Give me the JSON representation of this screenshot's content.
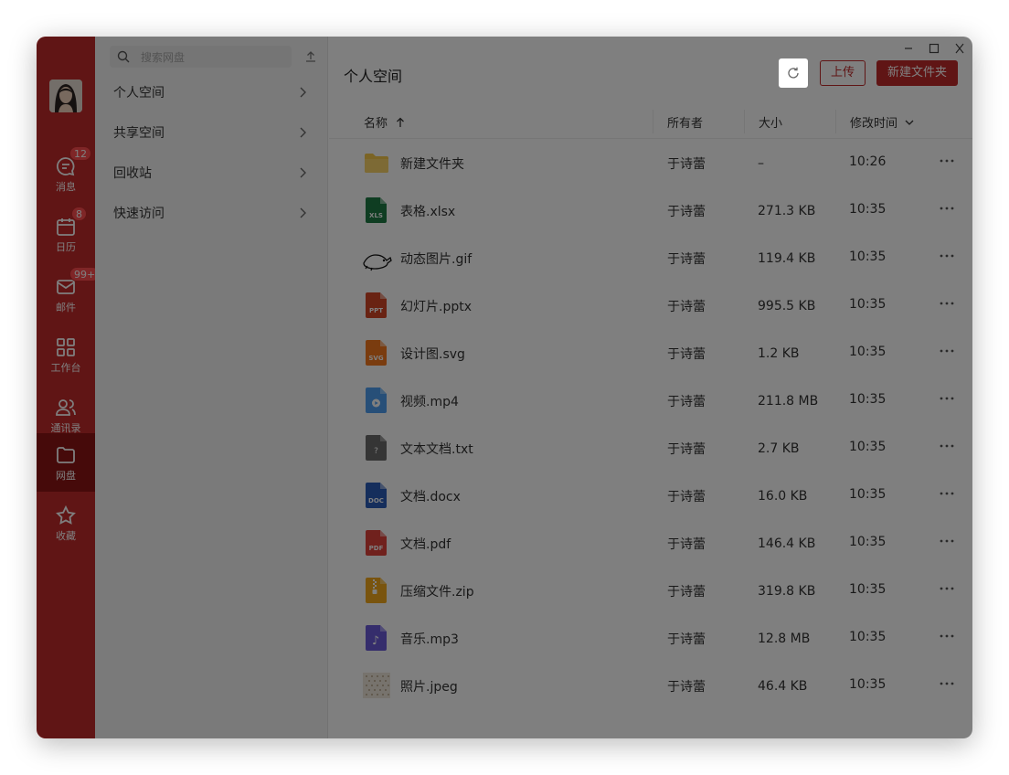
{
  "colors": {
    "brand": "#c12a2a",
    "brand_dark": "#8d1515",
    "badge": "#ff4d4f"
  },
  "rail": {
    "items": [
      {
        "label": "消息",
        "icon": "message-icon",
        "badge": "12"
      },
      {
        "label": "日历",
        "icon": "calendar-icon",
        "badge": "8"
      },
      {
        "label": "邮件",
        "icon": "mail-icon",
        "badge": "99+"
      },
      {
        "label": "工作台",
        "icon": "grid-icon",
        "badge": ""
      },
      {
        "label": "通讯录",
        "icon": "contacts-icon",
        "badge": ""
      },
      {
        "label": "网盘",
        "icon": "folder-icon",
        "badge": "",
        "active": true
      },
      {
        "label": "收藏",
        "icon": "star-icon",
        "badge": ""
      }
    ]
  },
  "panel": {
    "search_placeholder": "搜索网盘",
    "items": [
      {
        "label": "个人空间"
      },
      {
        "label": "共享空间"
      },
      {
        "label": "回收站"
      },
      {
        "label": "快速访问"
      }
    ]
  },
  "main": {
    "title": "个人空间",
    "upload_label": "上传",
    "new_folder_label": "新建文件夹",
    "columns": {
      "name": "名称",
      "owner": "所有者",
      "size": "大小",
      "modified": "修改时间"
    },
    "files": [
      {
        "name": "新建文件夹",
        "owner": "于诗蕾",
        "size": "–",
        "time": "10:26",
        "type": "folder"
      },
      {
        "name": "表格.xlsx",
        "owner": "于诗蕾",
        "size": "271.3 KB",
        "time": "10:35",
        "type": "xls"
      },
      {
        "name": "动态图片.gif",
        "owner": "于诗蕾",
        "size": "119.4 KB",
        "time": "10:35",
        "type": "gif"
      },
      {
        "name": "幻灯片.pptx",
        "owner": "于诗蕾",
        "size": "995.5 KB",
        "time": "10:35",
        "type": "ppt"
      },
      {
        "name": "设计图.svg",
        "owner": "于诗蕾",
        "size": "1.2 KB",
        "time": "10:35",
        "type": "svg"
      },
      {
        "name": "视频.mp4",
        "owner": "于诗蕾",
        "size": "211.8 MB",
        "time": "10:35",
        "type": "video"
      },
      {
        "name": "文本文档.txt",
        "owner": "于诗蕾",
        "size": "2.7 KB",
        "time": "10:35",
        "type": "txt"
      },
      {
        "name": "文档.docx",
        "owner": "于诗蕾",
        "size": "16.0 KB",
        "time": "10:35",
        "type": "doc"
      },
      {
        "name": "文档.pdf",
        "owner": "于诗蕾",
        "size": "146.4 KB",
        "time": "10:35",
        "type": "pdf"
      },
      {
        "name": "压缩文件.zip",
        "owner": "于诗蕾",
        "size": "319.8 KB",
        "time": "10:35",
        "type": "zip"
      },
      {
        "name": "音乐.mp3",
        "owner": "于诗蕾",
        "size": "12.8 MB",
        "time": "10:35",
        "type": "audio"
      },
      {
        "name": "照片.jpeg",
        "owner": "于诗蕾",
        "size": "46.4 KB",
        "time": "10:35",
        "type": "image"
      }
    ]
  }
}
